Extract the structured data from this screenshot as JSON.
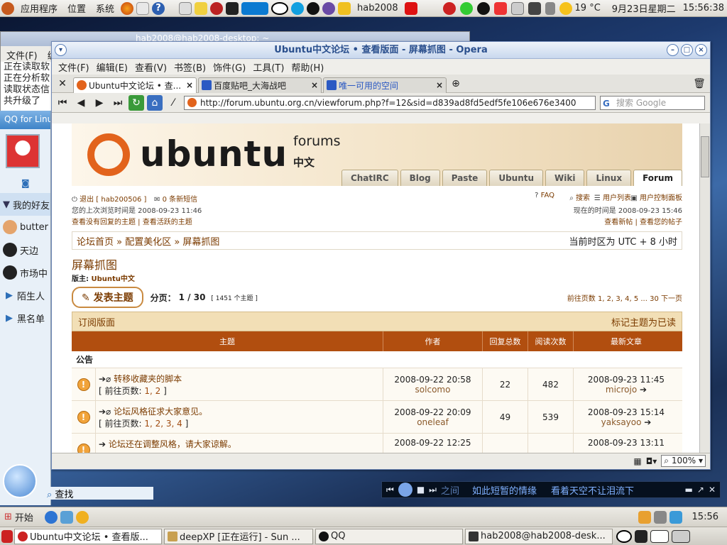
{
  "top_panel": {
    "menu": [
      "应用程序",
      "位置",
      "系统"
    ],
    "user": "hab2008",
    "weather": "19 °C",
    "date": "9月23日星期二",
    "time": "15:56:38"
  },
  "terminal": {
    "title": "hab2008@hab2008-desktop: ~",
    "menu_file": "文件(F)",
    "menu_edit": "编",
    "lines": [
      "正在读取软",
      "正在分析软",
      "读取状态信",
      "共升级了"
    ]
  },
  "qq": {
    "header": "QQ for Linux",
    "group": "我的好友",
    "friends": [
      "butter",
      "天边",
      "市场中"
    ],
    "strangers": "陌生人",
    "blacklist": "黑名单",
    "search": "查找"
  },
  "opera": {
    "title": "Ubuntu中文论坛 • 查看版面 - 屏幕抓图 - Opera",
    "menu": [
      "文件(F)",
      "编辑(E)",
      "查看(V)",
      "书签(B)",
      "饰件(G)",
      "工具(T)",
      "帮助(H)"
    ],
    "tabs": [
      {
        "label": "Ubuntu中文论坛 • 查...",
        "color": "#e2631c"
      },
      {
        "label": "百度贴吧_大海战吧",
        "color": "#2b59c3"
      },
      {
        "label": "唯一可用的空间",
        "color": "#2b59c3"
      }
    ],
    "url": "http://forum.ubuntu.org.cn/viewforum.php?f=12&sid=d839ad8fd5edf5fe106e676e3400",
    "search_placeholder": "搜索 Google",
    "zoom": "100%"
  },
  "page": {
    "logo": "ubuntu",
    "logo_forums": "forums",
    "logo_zh": "中文",
    "nav_tabs": [
      "ChatIRC",
      "Blog",
      "Paste",
      "Ubuntu",
      "Wiki",
      "Linux",
      "Forum"
    ],
    "logout": "退出 [ hab200506 ]",
    "pm": "0 条新短信",
    "last_visit": "您的上次浏览时间是 2008-09-23 11:46",
    "links_left": "查看没有回复的主题 | 查看活跃的主题",
    "faq": "FAQ",
    "search": "搜索",
    "memberlist": "用户列表",
    "ucp": "用户控制面板",
    "current_time": "现在的时间是 2008-09-23 15:46",
    "links_right": "查看新帖 | 查看您的帖子",
    "crumb": "论坛首页 » 配置美化区 » 屏幕抓图",
    "timezone": "当前时区为 UTC + 8 小时",
    "forum_title": "屏幕抓图",
    "moderator_label": "版主:",
    "moderator": "Ubuntu中文",
    "new_topic": "发表主题",
    "pagination_label": "分页：",
    "pagination": "1 / 30",
    "topic_count": "[ 1451 个主题 ]",
    "goto_pages": "前往页数 1, 2, 3, 4, 5 ... 30  下一页",
    "subscribe": "订阅版面",
    "mark_read": "标记主题为已读",
    "headers": {
      "topic": "主题",
      "author": "作者",
      "replies": "回复总数",
      "views": "阅读次数",
      "last": "最新文章"
    },
    "announce_label": "公告",
    "topics": [
      {
        "title": "转移收藏夹的脚本",
        "pages_prefix": "[ 前往页数:",
        "pages": "1, 2",
        "pages_suffix": "]",
        "date": "2008-09-22 20:58",
        "author": "solcomo",
        "replies": "22",
        "views": "482",
        "last_date": "2008-09-23 11:45",
        "last_author": "microjo"
      },
      {
        "title": "论坛风格征求大家意见。",
        "pages_prefix": "[ 前往页数:",
        "pages": "1, 2, 3, 4",
        "pages_suffix": "]",
        "date": "2008-09-22 20:09",
        "author": "oneleaf",
        "replies": "49",
        "views": "539",
        "last_date": "2008-09-23 15:14",
        "last_author": "yaksayoo"
      },
      {
        "title": "论坛还在调整风格，请大家谅解。",
        "pages_prefix": "",
        "pages": "",
        "pages_suffix": "",
        "date": "2008-09-22 12:25",
        "author": "",
        "replies": "",
        "views": "",
        "last_date": "2008-09-23 13:11",
        "last_author": ""
      }
    ]
  },
  "music": {
    "separator": "之间",
    "song1": "如此短暂的情缘",
    "song2": "看着天空不让泪流下"
  },
  "start_bar": {
    "start": "开始",
    "time": "15:56"
  },
  "taskbar": {
    "tasks": [
      "Ubuntu中文论坛 • 查看版...",
      "deepXP [正在运行] - Sun ...",
      "QQ",
      "hab2008@hab2008-desk..."
    ]
  }
}
